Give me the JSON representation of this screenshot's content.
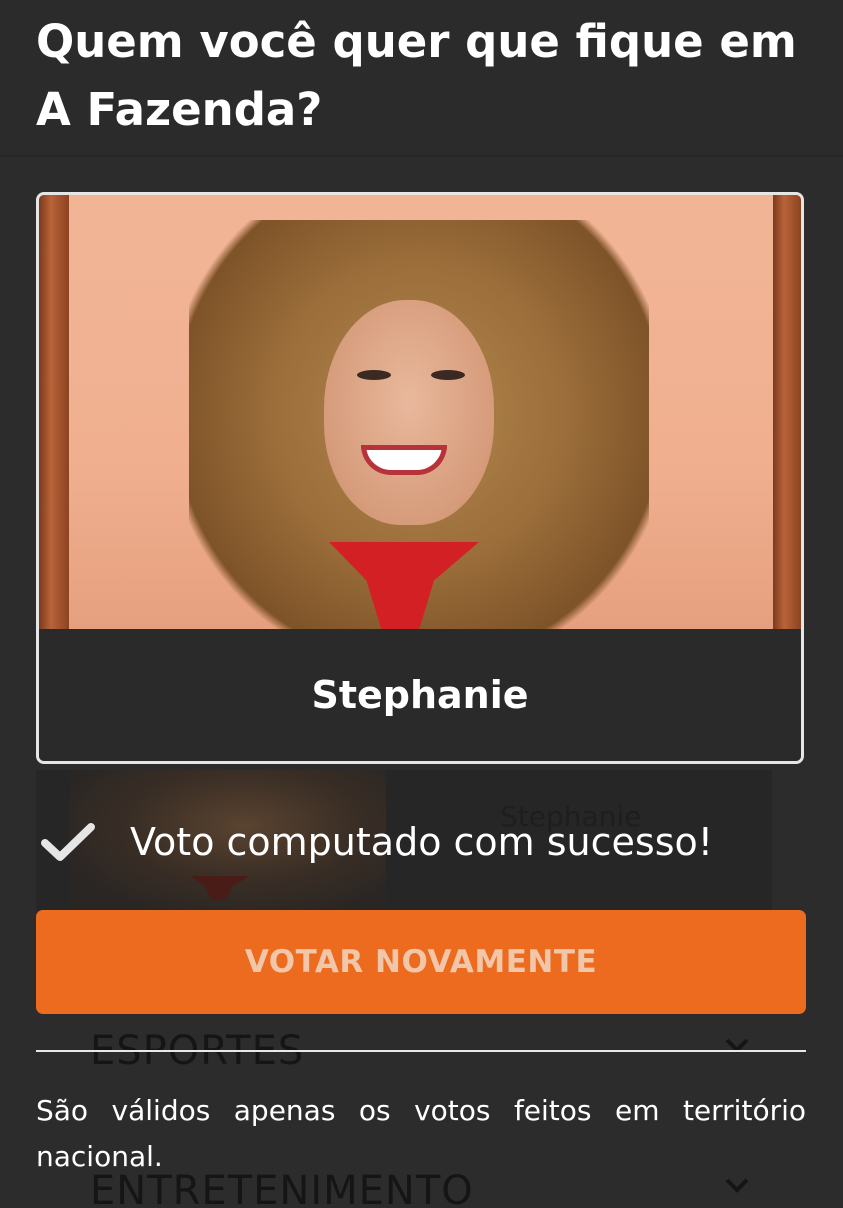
{
  "poll": {
    "title": "Quem você quer que fique em A Fazenda?"
  },
  "selected": {
    "name": "Stephanie"
  },
  "background": {
    "candidate_name": "Stephanie",
    "sections": [
      "ESPORTES",
      "ENTRETENIMENTO"
    ]
  },
  "confirmation": {
    "icon": "check-icon",
    "message": "Voto computado com sucesso!"
  },
  "actions": {
    "vote_again_label": "VOTAR NOVAMENTE"
  },
  "footer": {
    "notice": "São válidos apenas os votos feitos em território nacional."
  },
  "colors": {
    "background": "#2c2c2d",
    "accent": "#ec6b1f"
  }
}
